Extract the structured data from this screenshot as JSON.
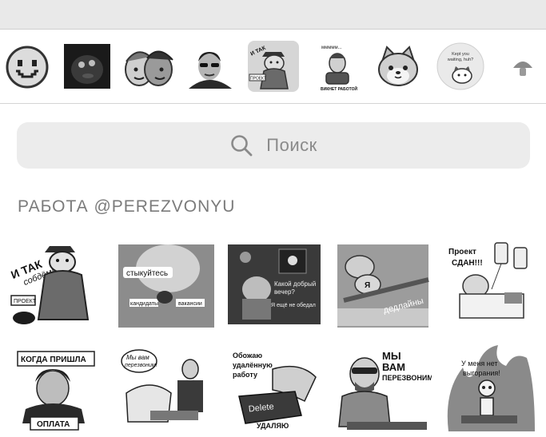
{
  "colors": {
    "topbar": "#e9e9e9",
    "search_bg": "#ececec",
    "search_text": "#8a8a8a",
    "section_title": "#7b7b7b",
    "selected_pack": "#d6d6d6"
  },
  "pack_bar": {
    "packs": [
      {
        "icon": "smiley-pixel-icon"
      },
      {
        "icon": "dark-creature-icon"
      },
      {
        "icon": "two-faces-icon"
      },
      {
        "icon": "man-sunglasses-icon"
      },
      {
        "icon": "official-character-icon",
        "selected": true,
        "texts": [
          "И ТАК",
          "ПРОЕКТ"
        ]
      },
      {
        "icon": "office-worker-icon",
        "texts": [
          "ммммм...",
          "ВИКНЕТ РАБОТОЙ"
        ]
      },
      {
        "icon": "shiba-dog-icon"
      },
      {
        "icon": "kept-waiting-cat-icon",
        "texts": [
          "Kept you",
          "waiting, huh?"
        ]
      },
      {
        "icon": "mushroom-icon"
      }
    ]
  },
  "search": {
    "icon": "search-icon",
    "placeholder": "Поиск"
  },
  "section": {
    "title": "РАБОТА @PEREZVONYU"
  },
  "stickers": [
    {
      "icon": "official-sticker",
      "texts": [
        "И ТАК",
        "собдём!",
        "ПРОЕКТ"
      ]
    },
    {
      "icon": "cat-shake-sticker",
      "texts": [
        "стыкуйтесь",
        "кандидаты",
        "вакансии"
      ]
    },
    {
      "icon": "night-office-sticker",
      "texts": [
        "Какой добрый",
        "вечер?",
        "Я ещё не обедал"
      ]
    },
    {
      "icon": "hamster-dead-sticker",
      "texts": [
        "Я",
        "дедлайны"
      ]
    },
    {
      "icon": "hospital-sticker",
      "texts": [
        "Проект",
        "СДАН!!!"
      ]
    },
    {
      "icon": "woman-cry-sticker",
      "texts": [
        "КОГДА ПРИШЛА",
        "ОПЛАТА"
      ]
    },
    {
      "icon": "interview-sticker",
      "texts": [
        "Мы вам",
        "перезвоним!"
      ]
    },
    {
      "icon": "delete-key-sticker",
      "texts": [
        "Обожаю",
        "удалённую",
        "работу",
        "Delete",
        "УДАЛЯЮ"
      ]
    },
    {
      "icon": "hipster-call-sticker",
      "texts": [
        "МЫ",
        "ВАМ",
        "ПЕРЕЗВОНИМ!"
      ]
    },
    {
      "icon": "skeleton-fire-sticker",
      "texts": [
        "У меня нет",
        "выгорания!"
      ]
    }
  ]
}
